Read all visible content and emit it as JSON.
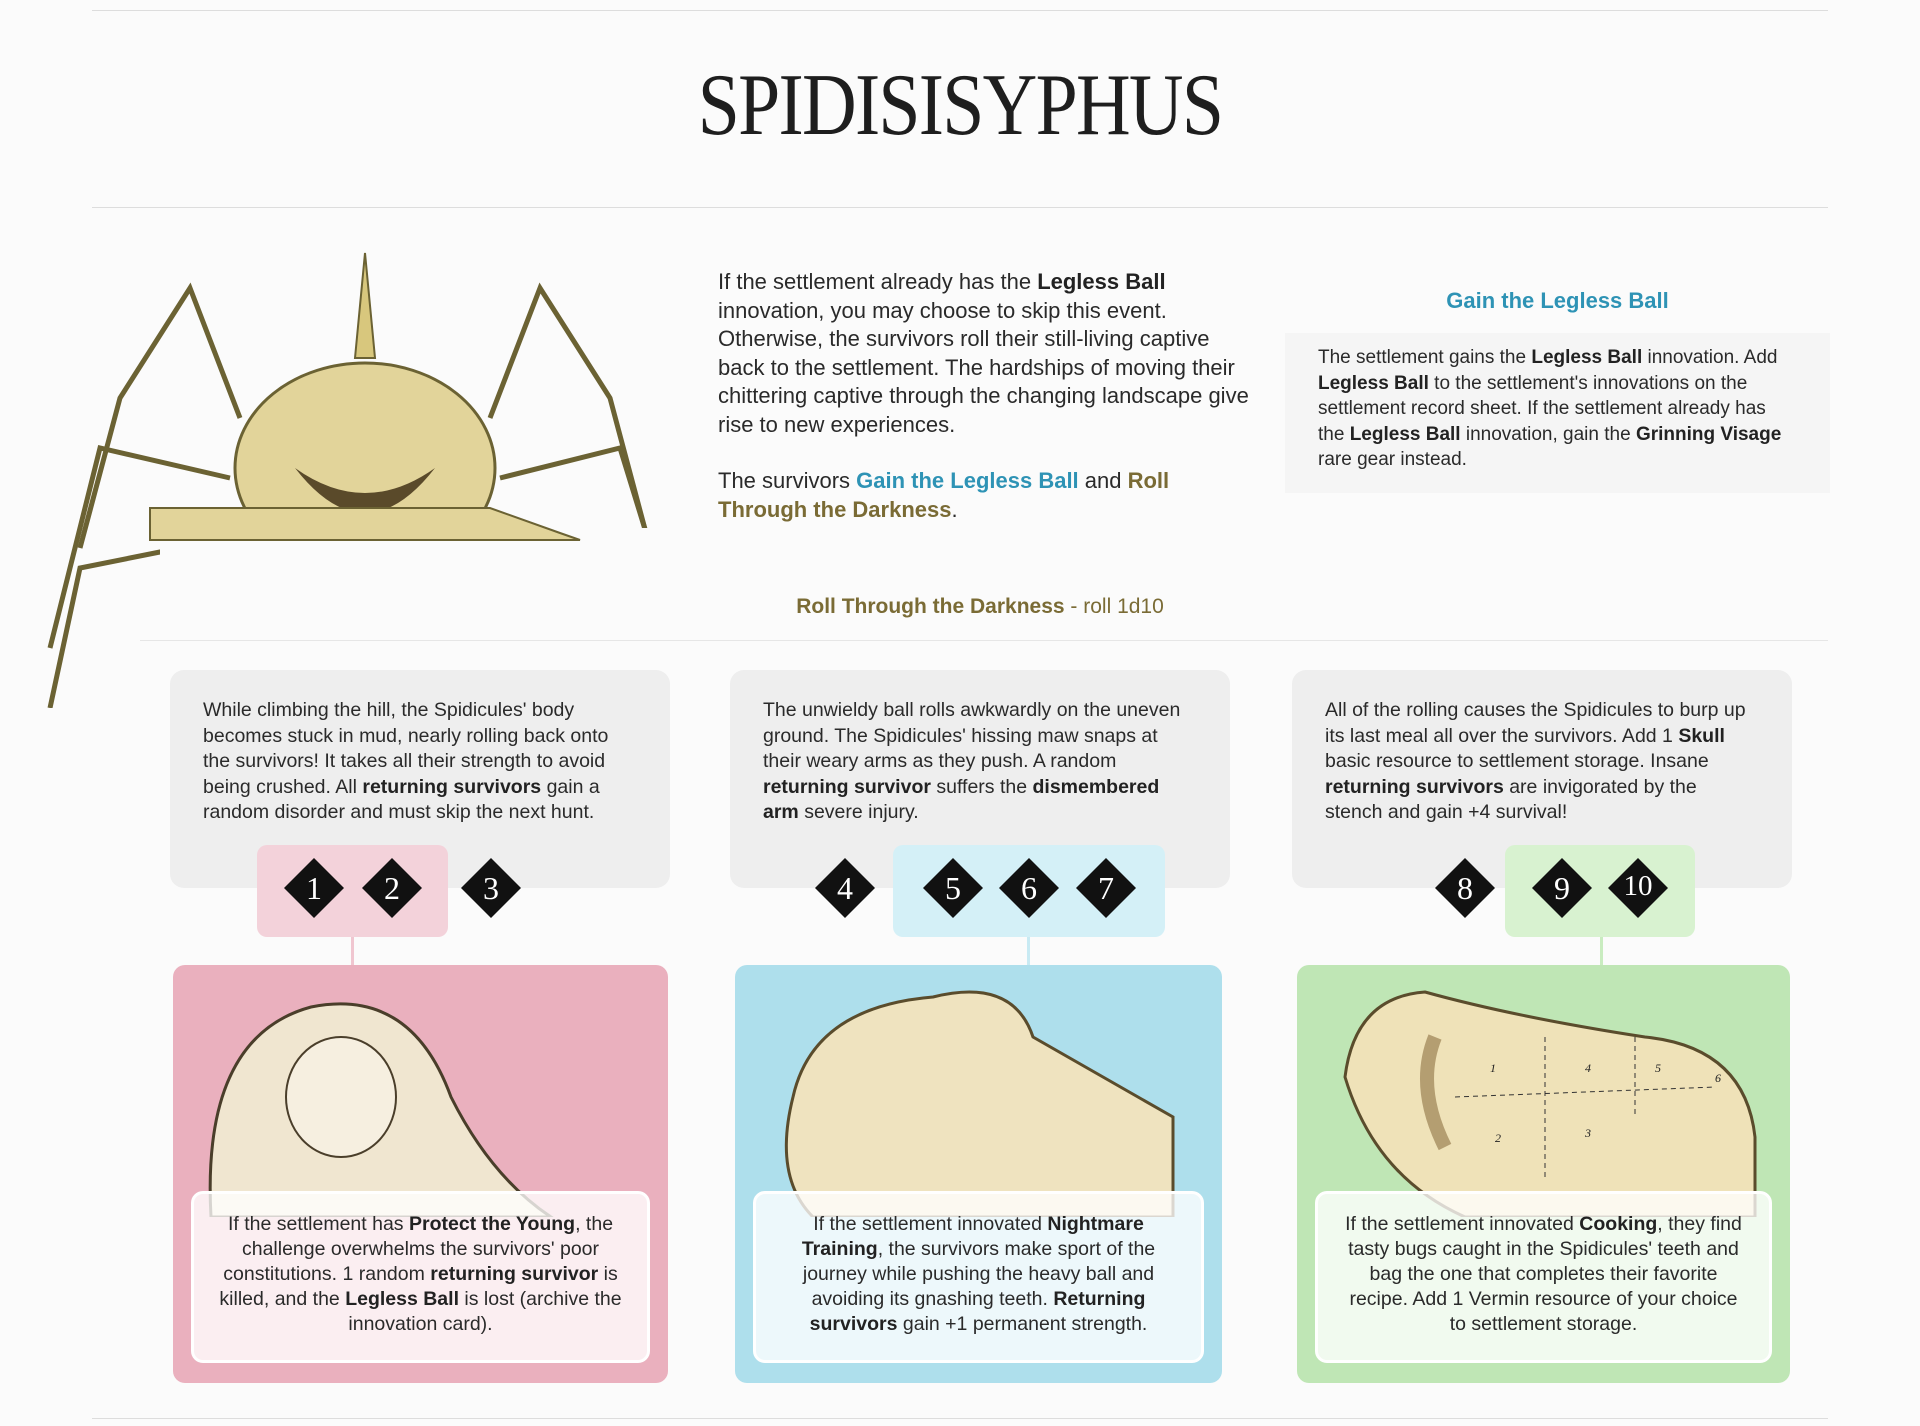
{
  "title": "SPIDISISYPHUS",
  "intro": {
    "p1_a": "If the settlement already has the ",
    "p1_b": "Legless Ball",
    "p1_c": " innovation, you may choose to skip this event. Otherwise, the survivors roll their still-living captive back to the settlement. The hardships of moving their chittering captive through the changing landscape give rise to new experiences.",
    "p2_a": "The survivors ",
    "p2_link1": "Gain the Legless Ball",
    "p2_b": " and ",
    "p2_link2": "Roll Through the Darkness",
    "p2_c": "."
  },
  "gain": {
    "title": "Gain the Legless Ball",
    "t1": "The settlement gains the ",
    "b1": "Legless Ball",
    "t2": " innovation. Add ",
    "b2": "Legless Ball",
    "t3": " to the settlement's innovations on the settlement record sheet. If the settlement already has the ",
    "b3": "Legless Ball",
    "t4": " innovation, gain the ",
    "b4": "Grinning Visage",
    "t5": " rare gear instead."
  },
  "roll": {
    "title": "Roll Through the Darkness",
    "sub": " - roll 1d10"
  },
  "colors": {
    "teal": "#2e93b5",
    "olive": "#7a6b35",
    "pink": "#eab0be",
    "blue": "#aedfec",
    "green": "#bfe6b5"
  },
  "results": [
    {
      "t1": "While climbing the hill, the Spidicules' body becomes stuck in mud, nearly rolling back onto the survivors! It takes all their strength to avoid being crushed. All ",
      "b1": "returning survivors",
      "t2": " gain a random disorder and must skip the next hunt.",
      "t3": "",
      "b2": "",
      "t4": "",
      "dice": [
        "1",
        "2",
        "3"
      ],
      "bonus": {
        "t1": "If the settlement has ",
        "b1": "Protect the Young",
        "t2": ", the challenge overwhelms the survivors' poor constitutions. 1 random ",
        "b2": "returning survivor",
        "t3": " is killed, and the ",
        "b3": "Legless Ball",
        "t4": " is lost (archive the innovation card)."
      }
    },
    {
      "t1": "The unwieldy ball rolls awkwardly on the uneven ground. The Spidicules' hissing maw snaps at their weary arms as they push. A random ",
      "b1": "returning survivor",
      "t2": " suffers the ",
      "b2": "dismembered arm",
      "t3": " severe injury.",
      "dice": [
        "4",
        "5",
        "6",
        "7"
      ],
      "bonus": {
        "t1": "If the settlement innovated ",
        "b1": "Nightmare Training",
        "t2": ", the survivors make sport of the journey while pushing the heavy ball and avoiding its gnashing teeth. ",
        "b2": "Returning survivors",
        "t3": " gain +1 permanent strength.",
        "b3": "",
        "t4": ""
      }
    },
    {
      "t1": "All of the rolling causes the Spidicules to burp up its last meal all over the survivors. Add 1 ",
      "b1": "Skull",
      "t2": " basic resource to settlement storage. Insane ",
      "b2": "returning survivors",
      "t3": " are invigorated by the stench and gain +4 survival!",
      "dice": [
        "8",
        "9",
        "10"
      ],
      "bonus": {
        "t1": "If the settlement innovated ",
        "b1": "Cooking",
        "t2": ", they find tasty bugs caught in the Spidicules' teeth and bag the one that completes their favorite recipe. Add 1 Vermin resource of your choice to settlement storage.",
        "b2": "",
        "t3": "",
        "b3": "",
        "t4": ""
      }
    }
  ],
  "lion_labels": [
    "1",
    "2",
    "3",
    "4",
    "5",
    "6"
  ]
}
